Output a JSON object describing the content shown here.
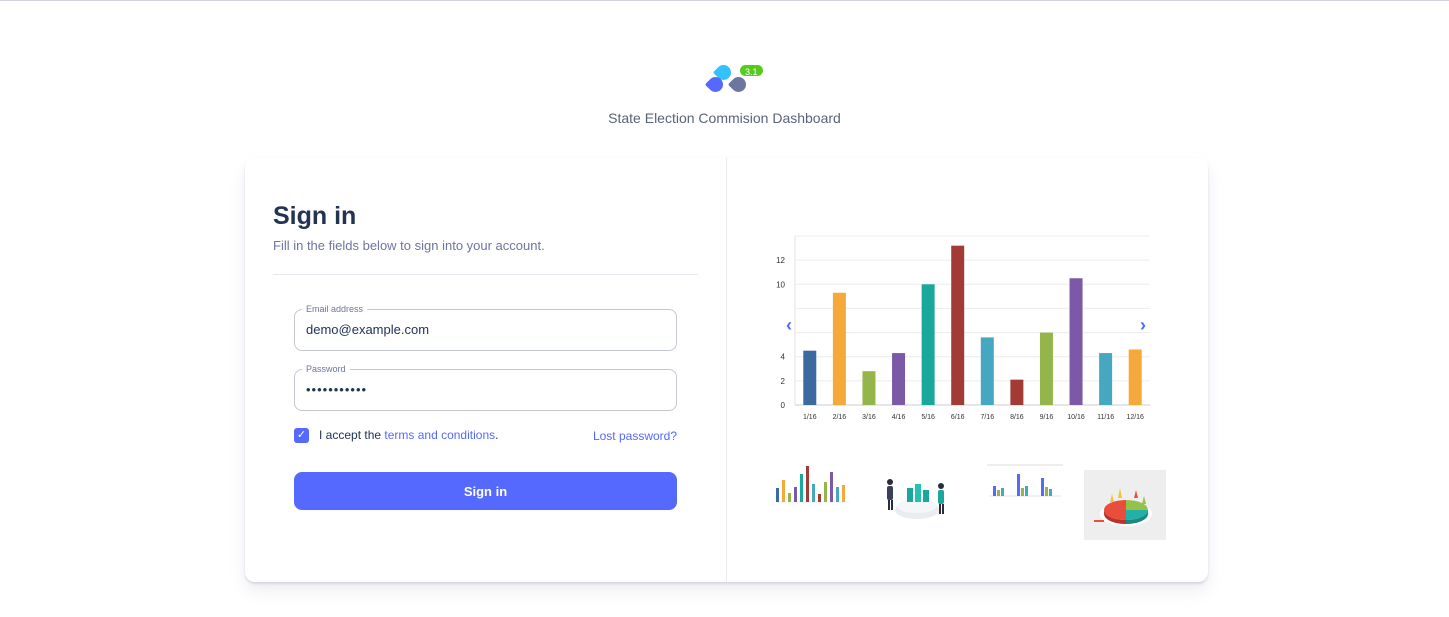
{
  "app": {
    "title": "State Election Commision Dashboard",
    "version_badge": "3.1"
  },
  "signin": {
    "title": "Sign in",
    "subtitle": "Fill in the fields below to sign into your account.",
    "email": {
      "label": "Email address",
      "value": "demo@example.com"
    },
    "password": {
      "label": "Password",
      "value": "•••••••••••"
    },
    "terms": {
      "checked": true,
      "prefix": "I accept the",
      "link": "terms and conditions",
      "suffix": "."
    },
    "lost_password": "Lost password?",
    "submit": "Sign in"
  },
  "carousel": {
    "prev_icon": "chevron-left-icon",
    "next_icon": "chevron-right-icon",
    "thumbnails": [
      "bar-chart-thumbnail",
      "people-chart-illustration-thumbnail",
      "multi-bar-chart-thumbnail",
      "3d-pie-chart-thumbnail"
    ]
  },
  "colors": {
    "accent": "#5569ff",
    "badge": "#57ca22",
    "title": "#223354"
  },
  "chart_data": {
    "type": "bar",
    "categories": [
      "1/16",
      "2/16",
      "3/16",
      "4/16",
      "5/16",
      "6/16",
      "7/16",
      "8/16",
      "9/16",
      "10/16",
      "11/16",
      "12/16"
    ],
    "values": [
      4.5,
      9.3,
      2.8,
      4.3,
      10,
      13.2,
      5.6,
      2.1,
      6,
      10.5,
      4.3,
      4.6
    ],
    "colors": [
      "#3b6aa0",
      "#f6a93b",
      "#94b54a",
      "#7b59a6",
      "#1aa79c",
      "#a23b36",
      "#45a7c0",
      "#a23b36",
      "#94b54a",
      "#7b59a6",
      "#45a7c0",
      "#f6a93b"
    ],
    "y_ticks": [
      0,
      2,
      4,
      10,
      12
    ],
    "ylim": [
      0,
      14
    ],
    "grid": true
  }
}
